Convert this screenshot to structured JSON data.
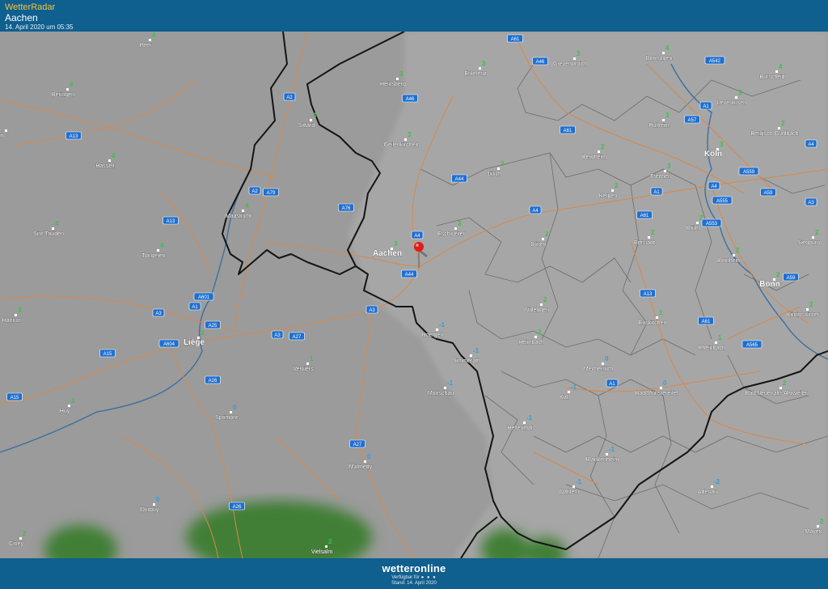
{
  "header": {
    "brand": "WetterRadar",
    "location": "Aachen",
    "timestamp": "14. April 2020 um 05:35"
  },
  "footer": {
    "logo": "wetteronline",
    "availability": "Verfügbar für",
    "stand": "Stand: 14. April 2020"
  },
  "colors": {
    "bar": "#0f5f8f",
    "brand": "#f3c53a",
    "temp_positive": "#3dbf4a",
    "temp_negative": "#2b9fe0",
    "road": "#d9884a",
    "border": "#141414",
    "region": "#6c6c6c",
    "river": "#3d6fa0",
    "highway_shield": "#1f6fd0",
    "pin": "#e01b1b",
    "moon": "#f5d90a"
  },
  "icons": [
    "location-pin-icon",
    "moon-icon"
  ],
  "cities": [
    {
      "name": "Peer",
      "temp": "4"
    },
    {
      "name": "Beringen",
      "temp": "4"
    },
    {
      "name": "Hasselt",
      "temp": "4"
    },
    {
      "name": "Sint-Truiden",
      "temp": "4"
    },
    {
      "name": "Tongeren",
      "temp": "4"
    },
    {
      "name": "Maastricht",
      "temp": "4"
    },
    {
      "name": "Sittard",
      "temp": "4"
    },
    {
      "name": "Heinsberg",
      "temp": "3"
    },
    {
      "name": "Erkelenz",
      "temp": "3"
    },
    {
      "name": "Grevenbroich",
      "temp": "3"
    },
    {
      "name": "Dormagen",
      "temp": "4"
    },
    {
      "name": "Burscheid",
      "temp": "4"
    },
    {
      "name": "Leverkusen",
      "temp": "3"
    },
    {
      "name": "Bergisch Gladbach",
      "temp": "2"
    },
    {
      "name": "Pulheim",
      "temp": "3"
    },
    {
      "name": "Köln",
      "temp": "3"
    },
    {
      "name": "Geilenkirchen",
      "temp": "3"
    },
    {
      "name": "Jülich",
      "temp": "3"
    },
    {
      "name": "Bergheim",
      "temp": "2"
    },
    {
      "name": "Frechen",
      "temp": "3"
    },
    {
      "name": "Kerpen",
      "temp": "2"
    },
    {
      "name": "Brühl",
      "temp": "2"
    },
    {
      "name": "Siegburg",
      "temp": "2"
    },
    {
      "name": "Aachen",
      "temp": "3"
    },
    {
      "name": "Eschweiler",
      "temp": "3"
    },
    {
      "name": "Düren",
      "temp": "2"
    },
    {
      "name": "Erftstadt",
      "temp": "2"
    },
    {
      "name": "Bornheim",
      "temp": "2"
    },
    {
      "name": "Bonn",
      "temp": "2"
    },
    {
      "name": "Hannut",
      "temp": "3"
    },
    {
      "name": "Liège",
      "temp": "3"
    },
    {
      "name": "Verviers",
      "temp": "1"
    },
    {
      "name": "Roetgen",
      "temp": "-1"
    },
    {
      "name": "Nideggen",
      "temp": "2"
    },
    {
      "name": "Euskirchen",
      "temp": "1"
    },
    {
      "name": "Königswinter",
      "temp": "2"
    },
    {
      "name": "Simmerath",
      "temp": "-1"
    },
    {
      "name": "Heimbach",
      "temp": "2"
    },
    {
      "name": "Rheinbach",
      "temp": "1"
    },
    {
      "name": "Mechernich",
      "temp": "0"
    },
    {
      "name": "Monschau",
      "temp": "-1"
    },
    {
      "name": "Kall",
      "temp": "-1"
    },
    {
      "name": "Bad Münstereifel",
      "temp": "0"
    },
    {
      "name": "Bad Neuenahr-Ahrweiler",
      "temp": "2"
    },
    {
      "name": "Huy",
      "temp": "3"
    },
    {
      "name": "Sprimont",
      "temp": "0"
    },
    {
      "name": "Hellenthal",
      "temp": "-1"
    },
    {
      "name": "Malmedy",
      "temp": "0"
    },
    {
      "name": "Blankenheim",
      "temp": "-1"
    },
    {
      "name": "Dahlem",
      "temp": "-1"
    },
    {
      "name": "Adenau",
      "temp": "-2"
    },
    {
      "name": "Durbuy",
      "temp": "0"
    },
    {
      "name": "Vielsalm",
      "temp": "2"
    },
    {
      "name": "Ciney",
      "temp": "2"
    },
    {
      "name": "Mayen",
      "temp": "2"
    },
    {
      "name": "m",
      "temp": ""
    }
  ],
  "highways": [
    "A61",
    "A46",
    "A542",
    "A2",
    "A46",
    "A1",
    "A57",
    "A13",
    "A61",
    "A4",
    "A2",
    "A79",
    "A44",
    "A559",
    "A1",
    "A4",
    "A555",
    "A59",
    "A3",
    "A76",
    "A13",
    "A61",
    "A553",
    "A4",
    "A4",
    "A44",
    "A59",
    "A3",
    "A601",
    "A1",
    "A13",
    "A3",
    "A25",
    "A3",
    "A27",
    "A61",
    "A15",
    "A604",
    "A565",
    "A26",
    "A1",
    "A15",
    "A27",
    "A26",
    "A27"
  ]
}
